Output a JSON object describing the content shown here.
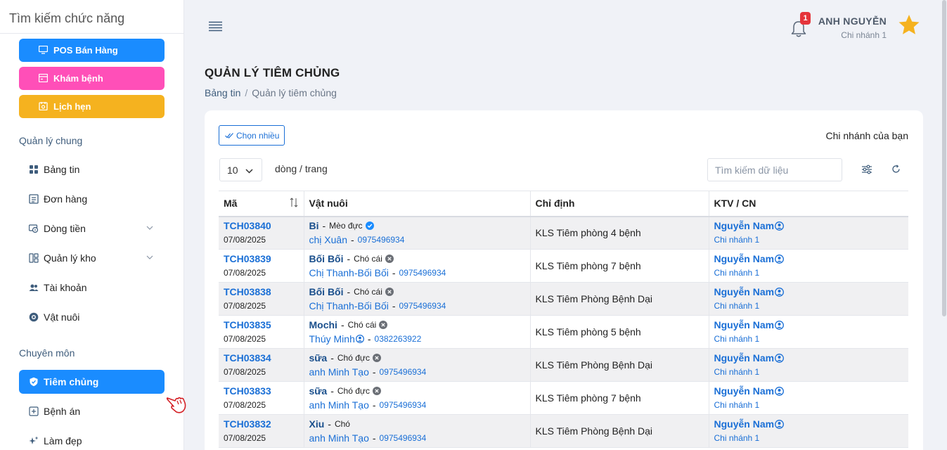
{
  "sidebar": {
    "search_placeholder": "Tìm kiếm chức năng",
    "quick_buttons": [
      {
        "label": "POS Bán Hàng",
        "icon": "monitor-icon",
        "color": "#1a8cff"
      },
      {
        "label": "Khám bệnh",
        "icon": "medical-card-icon",
        "color": "#ff4fb8"
      },
      {
        "label": "Lịch hẹn",
        "icon": "calendar-clock-icon",
        "color": "#f5b21f"
      }
    ],
    "sections": [
      "Quản lý chung",
      "Chuyên môn"
    ],
    "items": [
      {
        "label": "Bảng tin",
        "icon": "grid-icon"
      },
      {
        "label": "Đơn hàng",
        "icon": "list-icon"
      },
      {
        "label": "Dòng tiền",
        "icon": "money-icon",
        "expandable": true
      },
      {
        "label": "Quản lý kho",
        "icon": "warehouse-icon",
        "expandable": true
      },
      {
        "label": "Tài khoản",
        "icon": "users-icon"
      },
      {
        "label": "Vật nuôi",
        "icon": "paw-icon"
      },
      {
        "label": "Tiêm chủng",
        "icon": "shield-icon",
        "active": true
      },
      {
        "label": "Bệnh án",
        "icon": "medical-record-icon"
      },
      {
        "label": "Làm đẹp",
        "icon": "sparkle-icon"
      }
    ]
  },
  "header": {
    "notification_count": "1",
    "user_name": "ANH NGUYỄN",
    "user_branch": "Chi nhánh 1"
  },
  "page": {
    "title": "QUẢN LÝ TIÊM CHỦNG",
    "breadcrumb": {
      "home": "Bảng tin",
      "separator": "/",
      "current": "Quản lý tiêm chủng"
    }
  },
  "toolbar": {
    "multi_select_label": "Chọn nhiều",
    "branch_label": "Chi nhánh của bạn",
    "page_size": "10",
    "rows_per_page": "dòng / trang",
    "search_placeholder": "Tìm kiếm dữ liệu"
  },
  "table": {
    "columns": [
      "Mã",
      "Vật nuôi",
      "Chỉ định",
      "KTV / CN"
    ],
    "rows": [
      {
        "code": "TCH03840",
        "date": "07/08/2025",
        "pet": "Bi",
        "species": "Mèo đực",
        "status": "verified",
        "owner": "chị Xuân",
        "owner_badge": false,
        "phone": "0975496934",
        "spec": "KLS Tiêm phòng 4 bệnh",
        "ktv": "Nguyễn Nam",
        "branch": "Chi nhánh 1"
      },
      {
        "code": "TCH03839",
        "date": "07/08/2025",
        "pet": "Bối Bối",
        "species": "Chó cái",
        "status": "neutered",
        "owner": "Chị Thanh-Bối Bối",
        "owner_badge": false,
        "phone": "0975496934",
        "spec": "KLS Tiêm phòng 7 bệnh",
        "ktv": "Nguyễn Nam",
        "branch": "Chi nhánh 1"
      },
      {
        "code": "TCH03838",
        "date": "07/08/2025",
        "pet": "Bối Bối",
        "species": "Chó cái",
        "status": "neutered",
        "owner": "Chị Thanh-Bối Bối",
        "owner_badge": false,
        "phone": "0975496934",
        "spec": "KLS Tiêm Phòng Bệnh Dại",
        "ktv": "Nguyễn Nam",
        "branch": "Chi nhánh 1"
      },
      {
        "code": "TCH03835",
        "date": "07/08/2025",
        "pet": "Mochi",
        "species": "Chó cái",
        "status": "neutered",
        "owner": "Thúy Minh",
        "owner_badge": true,
        "phone": "0382263922",
        "spec": "KLS Tiêm phòng 5 bệnh",
        "ktv": "Nguyễn Nam",
        "branch": "Chi nhánh 1"
      },
      {
        "code": "TCH03834",
        "date": "07/08/2025",
        "pet": "sữa",
        "species": "Chó đực",
        "status": "neutered",
        "owner": "anh Minh Tạo",
        "owner_badge": false,
        "phone": "0975496934",
        "spec": "KLS Tiêm Phòng Bệnh Dại",
        "ktv": "Nguyễn Nam",
        "branch": "Chi nhánh 1"
      },
      {
        "code": "TCH03833",
        "date": "07/08/2025",
        "pet": "sữa",
        "species": "Chó đực",
        "status": "neutered",
        "owner": "anh Minh Tạo",
        "owner_badge": false,
        "phone": "0975496934",
        "spec": "KLS Tiêm phòng 7 bệnh",
        "ktv": "Nguyễn Nam",
        "branch": "Chi nhánh 1"
      },
      {
        "code": "TCH03832",
        "date": "07/08/2025",
        "pet": "Xiu",
        "species": "Chó",
        "status": "none",
        "owner": "anh Minh Tạo",
        "owner_badge": false,
        "phone": "0975496934",
        "spec": "KLS Tiêm Phòng Bệnh Dại",
        "ktv": "Nguyễn Nam",
        "branch": "Chi nhánh 1"
      }
    ]
  },
  "colors": {
    "primary": "#1a8cff",
    "link": "#1a6fd6",
    "pink": "#ff4fb8",
    "yellow": "#f5b21f",
    "badge": "#e5343b",
    "star": "#f5b21f"
  }
}
